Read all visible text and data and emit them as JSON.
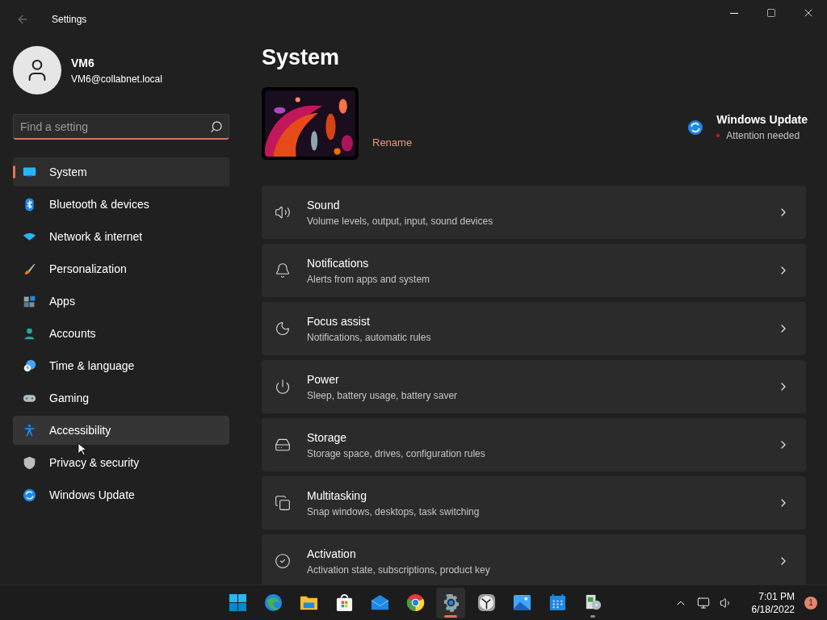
{
  "window": {
    "title": "Settings"
  },
  "user": {
    "name": "VM6",
    "email": "VM6@collabnet.local"
  },
  "search": {
    "placeholder": "Find a setting"
  },
  "sidebar": {
    "items": [
      {
        "label": "System",
        "selected": true,
        "hovered": false
      },
      {
        "label": "Bluetooth & devices",
        "selected": false,
        "hovered": false
      },
      {
        "label": "Network & internet",
        "selected": false,
        "hovered": false
      },
      {
        "label": "Personalization",
        "selected": false,
        "hovered": false
      },
      {
        "label": "Apps",
        "selected": false,
        "hovered": false
      },
      {
        "label": "Accounts",
        "selected": false,
        "hovered": false
      },
      {
        "label": "Time & language",
        "selected": false,
        "hovered": false
      },
      {
        "label": "Gaming",
        "selected": false,
        "hovered": false
      },
      {
        "label": "Accessibility",
        "selected": false,
        "hovered": true
      },
      {
        "label": "Privacy & security",
        "selected": false,
        "hovered": false
      },
      {
        "label": "Windows Update",
        "selected": false,
        "hovered": false
      }
    ]
  },
  "page": {
    "title": "System",
    "device_action": "Rename",
    "update": {
      "title": "Windows Update",
      "status": "Attention needed"
    }
  },
  "cards": [
    {
      "title": "Sound",
      "subtitle": "Volume levels, output, input, sound devices"
    },
    {
      "title": "Notifications",
      "subtitle": "Alerts from apps and system"
    },
    {
      "title": "Focus assist",
      "subtitle": "Notifications, automatic rules"
    },
    {
      "title": "Power",
      "subtitle": "Sleep, battery usage, battery saver"
    },
    {
      "title": "Storage",
      "subtitle": "Storage space, drives, configuration rules"
    },
    {
      "title": "Multitasking",
      "subtitle": "Snap windows, desktops, task switching"
    },
    {
      "title": "Activation",
      "subtitle": "Activation state, subscriptions, product key"
    }
  ],
  "taskbar": {
    "apps": [
      {
        "selected": false,
        "running": false
      },
      {
        "selected": false,
        "running": false
      },
      {
        "selected": false,
        "running": false
      },
      {
        "selected": false,
        "running": false
      },
      {
        "selected": false,
        "running": false
      },
      {
        "selected": false,
        "running": false
      },
      {
        "selected": true,
        "running": true
      },
      {
        "selected": false,
        "running": false
      },
      {
        "selected": false,
        "running": false
      },
      {
        "selected": false,
        "running": false
      },
      {
        "selected": false,
        "running": true
      }
    ],
    "time": "7:01 PM",
    "date": "6/18/2022",
    "notification_count": "1"
  }
}
